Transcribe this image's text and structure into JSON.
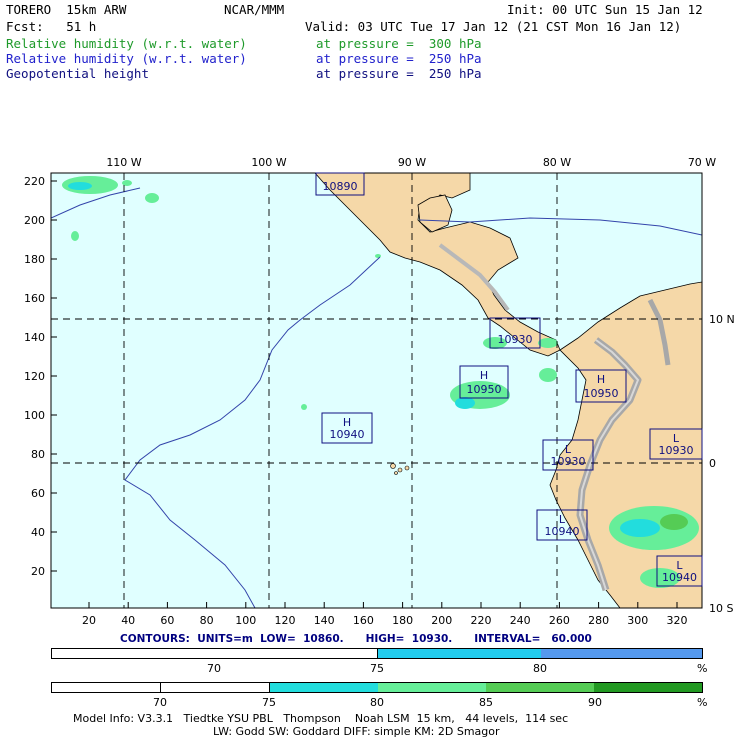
{
  "header": {
    "model": "TORERO  15km ARW",
    "center": "NCAR/MMM",
    "init": "Init: 00 UTC Sun 15 Jan 12",
    "fcst": "Fcst:   51 h",
    "valid": "Valid: 03 UTC Tue 17 Jan 12 (21 CST Mon 16 Jan 12)",
    "fields": [
      {
        "name": "Relative humidity (w.r.t. water)",
        "level": "at pressure =  300 hPa",
        "color": "#1e9a2a"
      },
      {
        "name": "Relative humidity (w.r.t. water)",
        "level": "at pressure =  250 hPa",
        "color": "#2222cc"
      },
      {
        "name": "Geopotential height",
        "level": "at pressure =  250 hPa",
        "color": "#101080"
      }
    ]
  },
  "map": {
    "lon_labels": [
      "110 W",
      "100 W",
      "90 W",
      "80 W",
      "70 W"
    ],
    "lat_labels": [
      "10 N",
      "0",
      "10 S"
    ],
    "y_ticks": [
      "220",
      "200",
      "180",
      "160",
      "140",
      "120",
      "100",
      "80",
      "60",
      "40",
      "20"
    ],
    "x_ticks": [
      "20",
      "40",
      "60",
      "80",
      "100",
      "120",
      "140",
      "160",
      "180",
      "200",
      "220",
      "240",
      "260",
      "280",
      "300",
      "320"
    ],
    "centers": [
      {
        "letter": "",
        "value": "10890"
      },
      {
        "letter": "",
        "value": "10930"
      },
      {
        "letter": "H",
        "value": "10950"
      },
      {
        "letter": "H",
        "value": "10950"
      },
      {
        "letter": "H",
        "value": "10940"
      },
      {
        "letter": "L",
        "value": "10930"
      },
      {
        "letter": "L",
        "value": "10930"
      },
      {
        "letter": "L",
        "value": "10940"
      },
      {
        "letter": "L",
        "value": "10940"
      }
    ],
    "colors": {
      "ocean": "#e0ffff",
      "land": "#f5d8a8",
      "mountain": "#b0b0b0",
      "grid": "#000000"
    }
  },
  "contour_info": "CONTOURS:  UNITS=m  LOW=  10860.      HIGH=  10930.      INTERVAL=   60.000",
  "colorbar_blue": {
    "labels": [
      "70",
      "75",
      "80",
      "%"
    ],
    "colors": [
      "#ffffff",
      "#22ccee",
      "#5599ee"
    ]
  },
  "colorbar_green": {
    "labels": [
      "70",
      "75",
      "80",
      "85",
      "90",
      "%"
    ],
    "colors": [
      "#ffffff",
      "#ffffff",
      "#22dddd",
      "#66ee99",
      "#55cc55",
      "#229922"
    ]
  },
  "footer": {
    "line1": "Model Info: V3.3.1   Tiedtke YSU PBL   Thompson    Noah LSM  15 km,   44 levels,  114 sec",
    "line2": "LW: Godd SW: Goddard DIFF: simple KM: 2D Smagor"
  }
}
